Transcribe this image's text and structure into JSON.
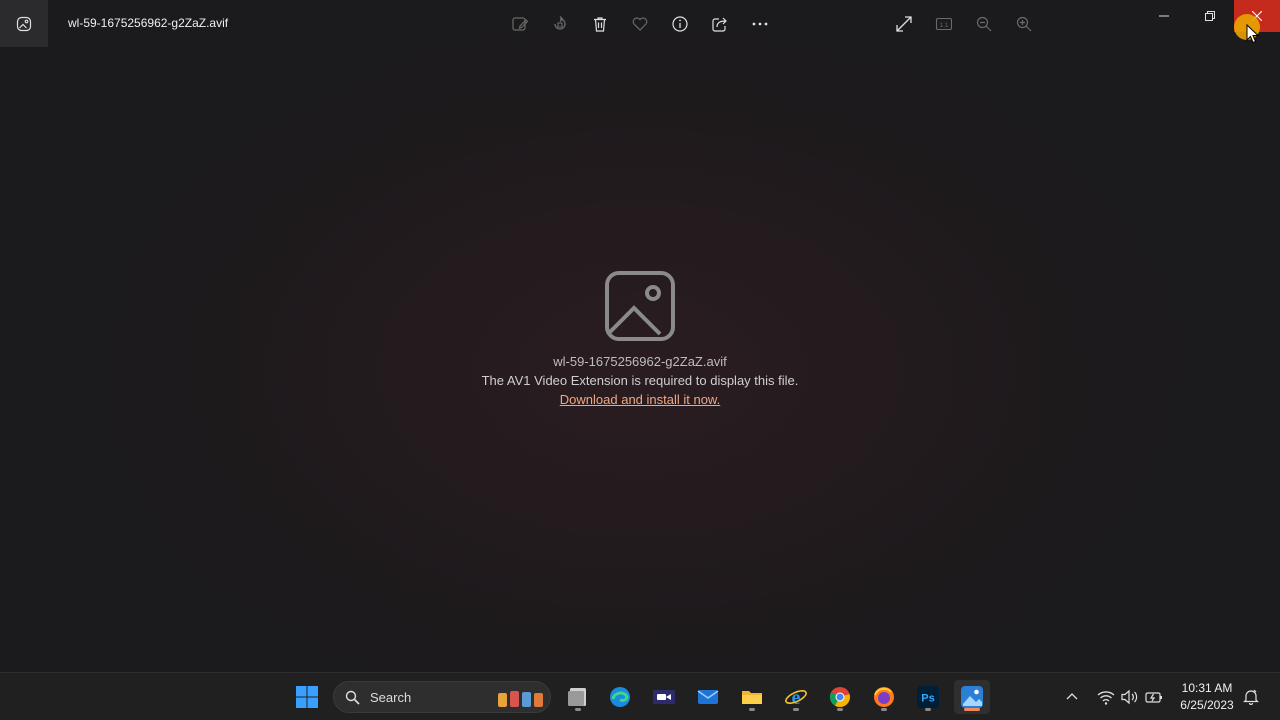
{
  "window": {
    "title": "wl-59-1675256962-g2ZaZ.avif"
  },
  "toolbar": {
    "items": [
      {
        "name": "edit-image-icon"
      },
      {
        "name": "rotate-icon"
      },
      {
        "name": "delete-icon"
      },
      {
        "name": "favorite-heart-icon"
      },
      {
        "name": "file-info-icon"
      },
      {
        "name": "share-icon"
      },
      {
        "name": "more-options-icon"
      },
      {
        "name": "full-screen-icon"
      },
      {
        "name": "actual-size-icon",
        "label": "1:1"
      },
      {
        "name": "zoom-out-icon"
      },
      {
        "name": "zoom-in-icon"
      }
    ]
  },
  "message": {
    "file_name": "wl-59-1675256962-g2ZaZ.avif",
    "text": "The AV1 Video Extension is required to display this file.",
    "link": "Download and install it now."
  },
  "taskbar": {
    "search_label": "Search",
    "apps": [
      {
        "name": "start-button",
        "icon": "windows-logo-icon"
      },
      {
        "name": "file-manager-app",
        "icon": "file-manager-icon"
      },
      {
        "name": "edge-app",
        "icon": "edge-icon"
      },
      {
        "name": "teams-meet-app",
        "icon": "video-camera-icon"
      },
      {
        "name": "mail-app",
        "icon": "mail-icon"
      },
      {
        "name": "file-explorer-app",
        "icon": "folder-icon"
      },
      {
        "name": "internet-explorer-app",
        "icon": "internet-explorer-icon"
      },
      {
        "name": "chrome-app",
        "icon": "chrome-icon"
      },
      {
        "name": "firefox-app",
        "icon": "firefox-icon"
      },
      {
        "name": "photoshop-app",
        "icon": "photoshop-icon",
        "label": "Ps"
      },
      {
        "name": "photos-app",
        "icon": "photos-icon"
      }
    ],
    "clock_time": "10:31 AM",
    "clock_date": "6/25/2023"
  },
  "colors": {
    "accent_link": "#f0a882",
    "close_button": "#c42b1c",
    "taskbar_bg": "#202020",
    "windows_blue": "#3aa0ff"
  }
}
